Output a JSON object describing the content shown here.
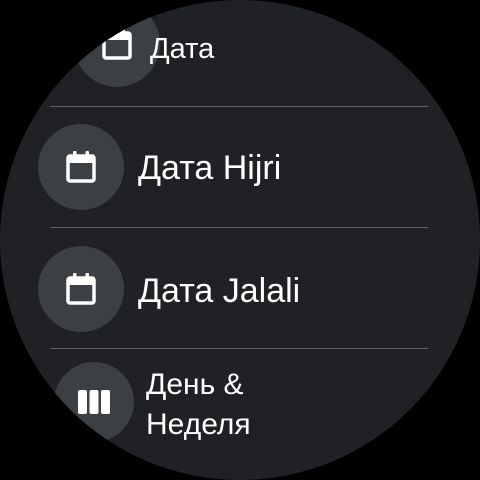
{
  "screen": {
    "background": "#202124",
    "accent_circle": "#3c4043",
    "divider_color": "#5f6368"
  },
  "items": [
    {
      "label": "Дата",
      "icon": "calendar-icon"
    },
    {
      "label": "Дата Hijri",
      "icon": "calendar-icon"
    },
    {
      "label": "Дата Jalali",
      "icon": "calendar-icon"
    },
    {
      "label_line1": "День &",
      "label_line2": "Неделя",
      "icon": "week-bars-icon"
    }
  ]
}
